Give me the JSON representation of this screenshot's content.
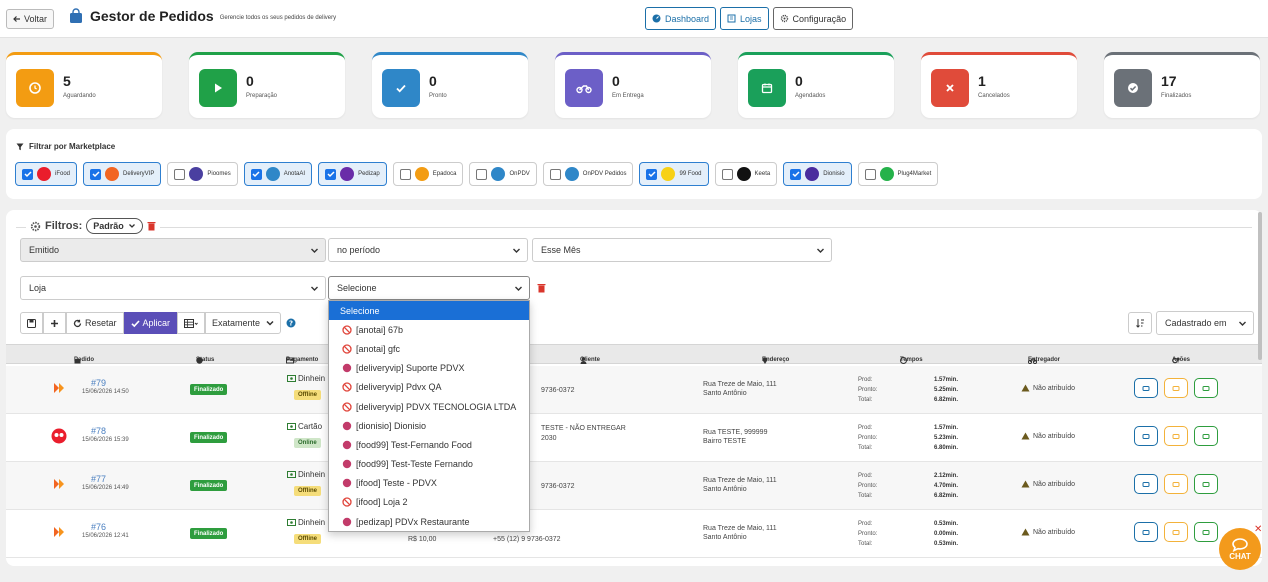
{
  "header": {
    "back_label": "Voltar",
    "title": "Gestor de Pedidos",
    "subtitle": "Gerencie todos os seus pedidos de delivery",
    "nav": [
      "Dashboard",
      "Lojas",
      "Configuração"
    ]
  },
  "stats": [
    {
      "count": "5",
      "label": "Aguardando",
      "color": "#f39c12"
    },
    {
      "count": "0",
      "label": "Preparação",
      "color": "#20a148"
    },
    {
      "count": "0",
      "label": "Pronto",
      "color": "#2f87c8"
    },
    {
      "count": "0",
      "label": "Em Entrega",
      "color": "#6c5fc7"
    },
    {
      "count": "0",
      "label": "Agendados",
      "color": "#1aa05a"
    },
    {
      "count": "1",
      "label": "Cancelados",
      "color": "#e04b3a"
    },
    {
      "count": "17",
      "label": "Finalizados",
      "color": "#6b7178"
    }
  ],
  "marketplace": {
    "title": "Filtrar por Marketplace",
    "chips": [
      {
        "label": "iFood",
        "checked": true,
        "color": "#ea1d2c"
      },
      {
        "label": "DeliveryVIP",
        "checked": true,
        "color": "#f26522"
      },
      {
        "label": "Pioomes",
        "checked": false,
        "color": "#4a3fa0"
      },
      {
        "label": "AnotaAI",
        "checked": true,
        "color": "#2f87c8"
      },
      {
        "label": "Pedizap",
        "checked": true,
        "color": "#6a2ca8"
      },
      {
        "label": "Epadoca",
        "checked": false,
        "color": "#f39c12"
      },
      {
        "label": "OnPDV",
        "checked": false,
        "color": "#2f87c8"
      },
      {
        "label": "OnPDV Pedidos",
        "checked": false,
        "color": "#2f87c8"
      },
      {
        "label": "99 Food",
        "checked": true,
        "color": "#f7d117"
      },
      {
        "label": "Keeta",
        "checked": false,
        "color": "#111111"
      },
      {
        "label": "Dionisio",
        "checked": true,
        "color": "#4a2c9e"
      },
      {
        "label": "Plug4Market",
        "checked": false,
        "color": "#25b24a"
      }
    ]
  },
  "filters": {
    "label": "Filtros:",
    "preset": "Padrão",
    "date_field": "Emitido",
    "period": "no período",
    "range": "Esse Mês",
    "store_field": "Loja",
    "store_value": "Selecione",
    "reset": "Resetar",
    "apply": "Aplicar",
    "match": "Exatamente",
    "sort": "Cadastrado em"
  },
  "table": {
    "headers": [
      "Pedido",
      "Status",
      "Pagamento",
      "Cliente",
      "Endereço",
      "Tempos",
      "Entregador",
      "Ações"
    ],
    "time_labels": [
      "Prod:",
      "Pronto:",
      "Total:"
    ],
    "rows": [
      {
        "number": "#79",
        "date": "15/06/2026 14:50",
        "source": "deliveryvip",
        "status": "Finalizado",
        "payment": "Dinhein",
        "pay_tag": "Offline",
        "client": "",
        "phone": "9736-0372",
        "addr1": "Rua Treze de Maio, 111",
        "addr2": "Santo Antônio",
        "prod": "1.57min.",
        "pronto": "5.25min.",
        "total": "6.82min.",
        "courier": "Não atribuído"
      },
      {
        "number": "#78",
        "date": "15/06/2026 15:39",
        "source": "ifood",
        "status": "Finalizado",
        "payment": "Cartão",
        "pay_tag": "Online",
        "client": "TESTE - NÃO ENTREGAR",
        "phone": "2030",
        "addr1": "Rua TESTE, 999999",
        "addr2": "Bairro TESTE",
        "prod": "1.57min.",
        "pronto": "5.23min.",
        "total": "6.80min.",
        "courier": "Não atribuído"
      },
      {
        "number": "#77",
        "date": "15/06/2026 14:49",
        "source": "deliveryvip",
        "status": "Finalizado",
        "payment": "Dinhein",
        "pay_tag": "Offline",
        "client": "",
        "phone": "9736-0372",
        "addr1": "Rua Treze de Maio, 111",
        "addr2": "Santo Antônio",
        "prod": "2.12min.",
        "pronto": "4.70min.",
        "total": "6.82min.",
        "courier": "Não atribuído"
      },
      {
        "number": "#76",
        "date": "15/06/2026 12:41",
        "source": "deliveryvip",
        "status": "Finalizado",
        "payment": "Dinhein",
        "pay_tag": "Offline",
        "client": "",
        "phone": "+55 (12) 9 9736-0372",
        "value": "R$ 10,00",
        "addr1": "Rua Treze de Maio, 111",
        "addr2": "Santo Antônio",
        "prod": "0.53min.",
        "pronto": "0.00min.",
        "total": "0.53min.",
        "courier": "Não atribuído"
      }
    ]
  },
  "dropdown": {
    "options": [
      {
        "label": "Selecione",
        "selected": true,
        "status": "none"
      },
      {
        "label": "[anotai] 67b",
        "status": "off"
      },
      {
        "label": "[anotai] gfc",
        "status": "off"
      },
      {
        "label": "[deliveryvip] Suporte PDVX",
        "status": "on"
      },
      {
        "label": "[deliveryvip] Pdvx QA",
        "status": "off"
      },
      {
        "label": "[deliveryvip] PDVX TECNOLOGIA LTDA",
        "status": "off"
      },
      {
        "label": "[dionisio] Dionisio",
        "status": "on"
      },
      {
        "label": "[food99] Test-Fernando Food",
        "status": "on"
      },
      {
        "label": "[food99] Test-Teste Fernando",
        "status": "on"
      },
      {
        "label": "[ifood] Teste - PDVX",
        "status": "on"
      },
      {
        "label": "[ifood] Loja 2",
        "status": "off"
      },
      {
        "label": "[pedizap] PDVx Restaurante",
        "status": "on"
      }
    ]
  },
  "chat_label": "CHAT",
  "colors": {
    "accent": "#1a73e8",
    "apply": "#5b4fb8",
    "danger": "#d9352b"
  }
}
